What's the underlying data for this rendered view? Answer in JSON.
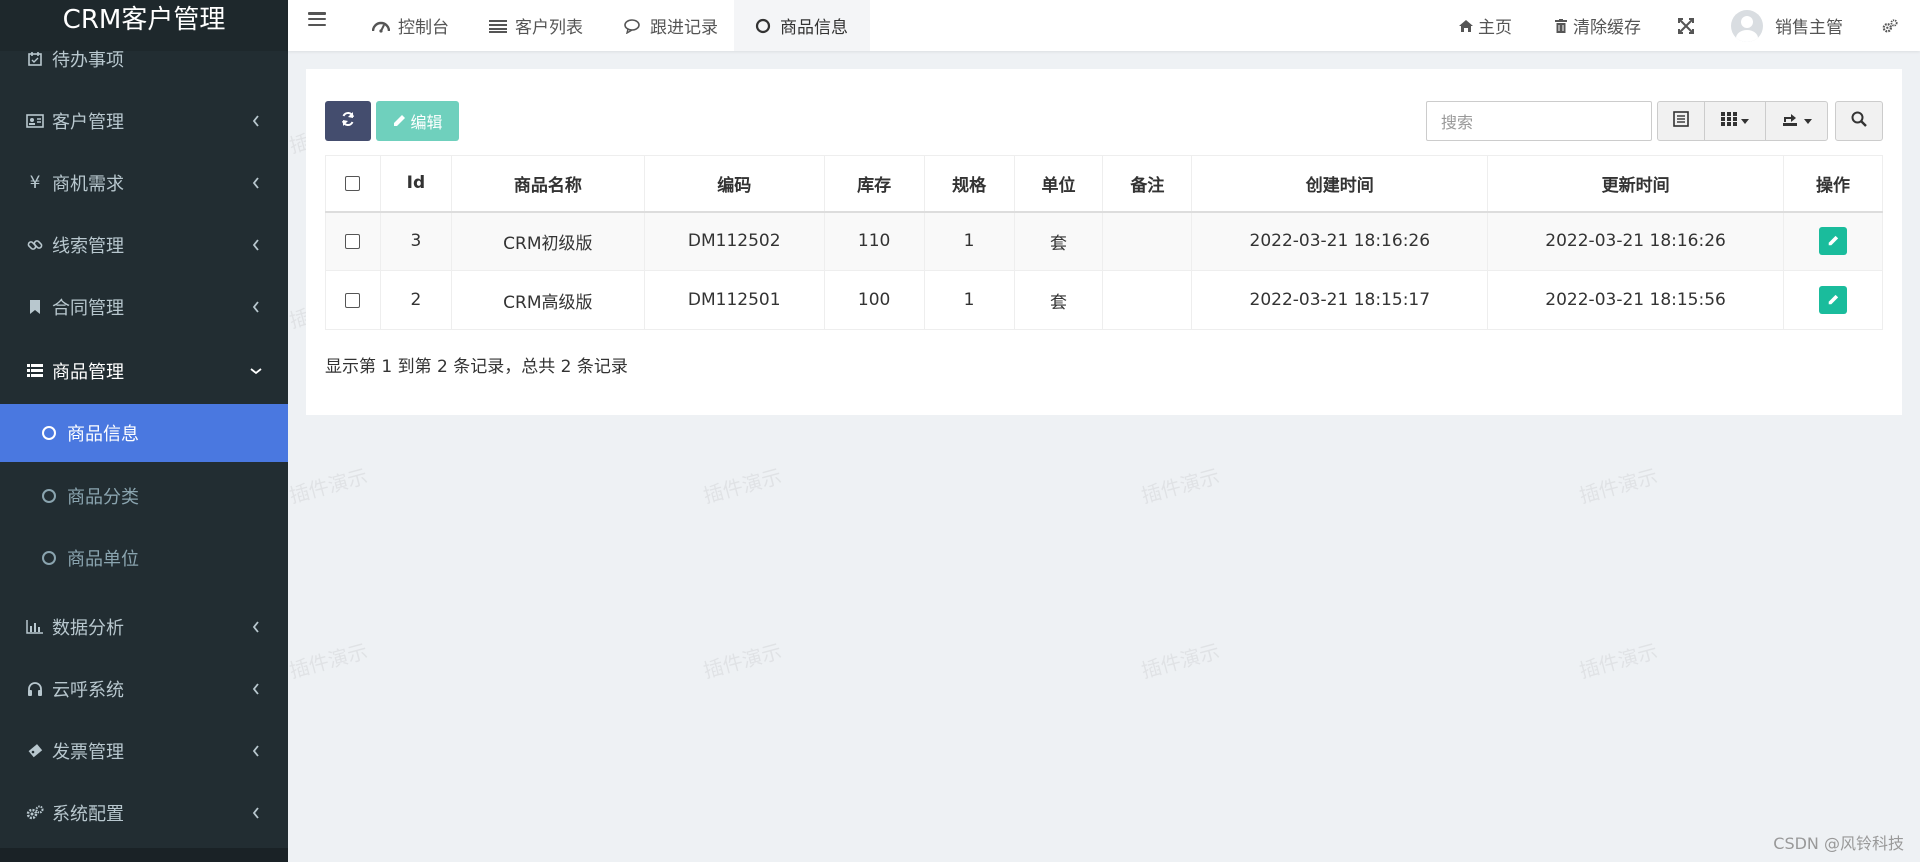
{
  "app": {
    "title": "CRM客户管理"
  },
  "sidebar": {
    "items": [
      {
        "label": "待办事项",
        "icon": "calendar-check-icon"
      },
      {
        "label": "客户管理",
        "icon": "id-card-icon"
      },
      {
        "label": "商机需求",
        "icon": "yen-icon"
      },
      {
        "label": "线索管理",
        "icon": "link-icon"
      },
      {
        "label": "合同管理",
        "icon": "bookmark-icon"
      },
      {
        "label": "商品管理",
        "icon": "list-icon"
      },
      {
        "label": "数据分析",
        "icon": "bar-chart-icon"
      },
      {
        "label": "云呼系统",
        "icon": "headphones-icon"
      },
      {
        "label": "发票管理",
        "icon": "ticket-icon"
      },
      {
        "label": "系统配置",
        "icon": "cogs-icon"
      }
    ],
    "submenu": [
      {
        "label": "商品信息",
        "active": true
      },
      {
        "label": "商品分类",
        "active": false
      },
      {
        "label": "商品单位",
        "active": false
      }
    ]
  },
  "header": {
    "tabs": [
      {
        "label": "控制台",
        "icon": "dashboard-icon"
      },
      {
        "label": "客户列表",
        "icon": "list-icon"
      },
      {
        "label": "跟进记录",
        "icon": "comments-icon"
      },
      {
        "label": "商品信息",
        "icon": "circle-icon",
        "active": true
      }
    ],
    "home_label": "主页",
    "clear_cache_label": "清除缓存",
    "user_name": "销售主管"
  },
  "toolbar": {
    "edit_label": "编辑",
    "search_placeholder": "搜索"
  },
  "table": {
    "headers": [
      "Id",
      "商品名称",
      "编码",
      "库存",
      "规格",
      "单位",
      "备注",
      "创建时间",
      "更新时间",
      "操作"
    ],
    "rows": [
      {
        "id": "3",
        "name": "CRM初级版",
        "code": "DM112502",
        "stock": "110",
        "spec": "1",
        "unit": "套",
        "note": "",
        "created": "2022-03-21 18:16:26",
        "updated": "2022-03-21 18:16:26"
      },
      {
        "id": "2",
        "name": "CRM高级版",
        "code": "DM112501",
        "stock": "100",
        "spec": "1",
        "unit": "套",
        "note": "",
        "created": "2022-03-21 18:15:17",
        "updated": "2022-03-21 18:15:56"
      }
    ],
    "summary": "显示第 1 到第 2 条记录，总共 2 条记录"
  },
  "watermark": "插件演示",
  "footer_credit": "CSDN @风铃科技",
  "colors": {
    "sidebar_bg": "#222d32",
    "active_submenu": "#4a78e0",
    "op_button": "#1abc9c",
    "edit_button": "#6fd0bd",
    "refresh_button": "#444d6e"
  }
}
